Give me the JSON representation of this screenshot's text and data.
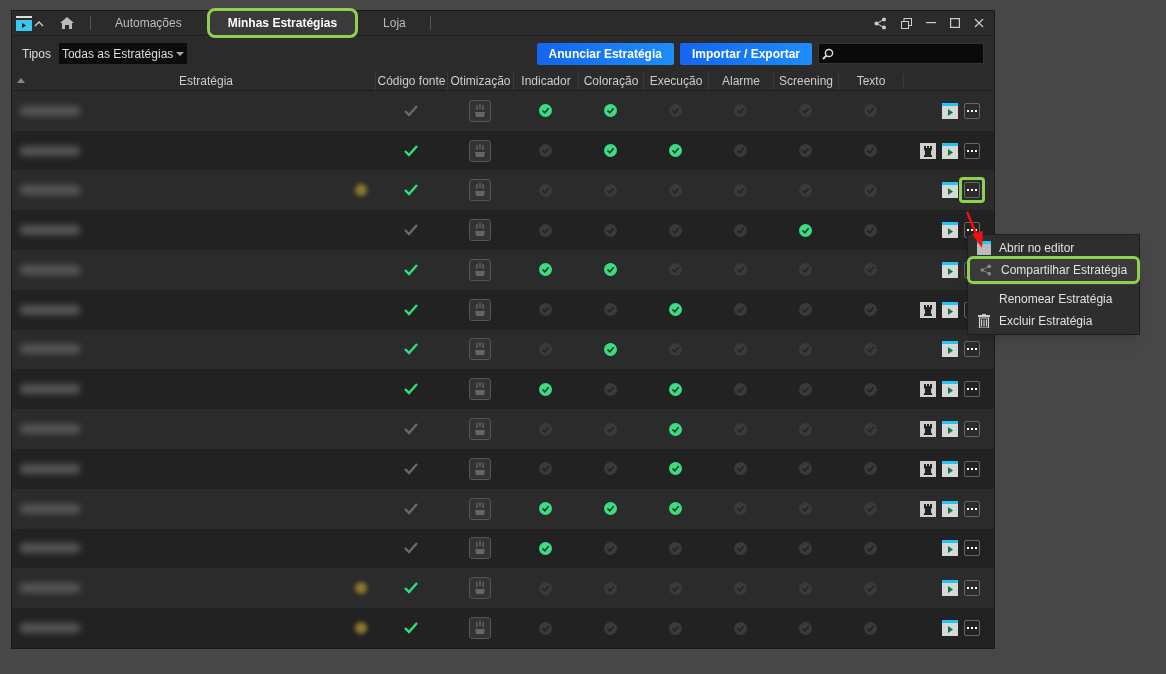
{
  "tabs": [
    {
      "label": "Automações",
      "selected": false,
      "highlighted": false
    },
    {
      "label": "Minhas Estratégias",
      "selected": true,
      "highlighted": true
    },
    {
      "label": "Loja",
      "selected": false,
      "highlighted": false
    }
  ],
  "filter": {
    "label": "Tipos",
    "value": "Todas as Estratégias"
  },
  "buttons": [
    "Anunciar Estratégia",
    "Importar / Exportar"
  ],
  "columns": [
    "Estratégia",
    "Código fonte",
    "Otimização",
    "Indicador",
    "Coloração",
    "Execução",
    "Alarme",
    "Screening",
    "Texto"
  ],
  "rows": [
    {
      "favorite": false,
      "source": false,
      "flags": [
        true,
        true,
        false,
        false,
        false,
        false
      ],
      "rook": false,
      "menu_highlighted": false
    },
    {
      "favorite": false,
      "source": true,
      "flags": [
        false,
        true,
        true,
        false,
        false,
        false
      ],
      "rook": true,
      "menu_highlighted": false
    },
    {
      "favorite": true,
      "source": true,
      "flags": [
        false,
        false,
        false,
        false,
        false,
        false
      ],
      "rook": false,
      "menu_highlighted": true
    },
    {
      "favorite": false,
      "source": false,
      "flags": [
        false,
        false,
        false,
        false,
        true,
        false
      ],
      "rook": false,
      "menu_highlighted": false
    },
    {
      "favorite": false,
      "source": true,
      "flags": [
        true,
        true,
        false,
        false,
        false,
        false
      ],
      "rook": false,
      "menu_highlighted": false
    },
    {
      "favorite": false,
      "source": true,
      "flags": [
        false,
        false,
        true,
        false,
        false,
        false
      ],
      "rook": true,
      "menu_highlighted": false
    },
    {
      "favorite": false,
      "source": true,
      "flags": [
        false,
        true,
        false,
        false,
        false,
        false
      ],
      "rook": false,
      "menu_highlighted": false
    },
    {
      "favorite": false,
      "source": true,
      "flags": [
        true,
        false,
        true,
        false,
        false,
        false
      ],
      "rook": true,
      "menu_highlighted": false
    },
    {
      "favorite": false,
      "source": false,
      "flags": [
        false,
        false,
        true,
        false,
        false,
        false
      ],
      "rook": true,
      "menu_highlighted": false
    },
    {
      "favorite": false,
      "source": false,
      "flags": [
        false,
        false,
        true,
        false,
        false,
        false
      ],
      "rook": true,
      "menu_highlighted": false
    },
    {
      "favorite": false,
      "source": false,
      "flags": [
        true,
        true,
        true,
        false,
        false,
        false
      ],
      "rook": true,
      "menu_highlighted": false
    },
    {
      "favorite": false,
      "source": false,
      "flags": [
        true,
        false,
        false,
        false,
        false,
        false
      ],
      "rook": false,
      "menu_highlighted": false
    },
    {
      "favorite": true,
      "source": true,
      "flags": [
        false,
        false,
        false,
        false,
        false,
        false
      ],
      "rook": false,
      "menu_highlighted": false
    },
    {
      "favorite": true,
      "source": true,
      "flags": [
        false,
        false,
        false,
        false,
        false,
        false
      ],
      "rook": false,
      "menu_highlighted": false
    }
  ],
  "context_menu": [
    {
      "label": "Abrir no editor",
      "kind": "editor",
      "highlighted": false
    },
    {
      "label": "Compartilhar Estratégia",
      "kind": "share",
      "highlighted": true
    },
    {
      "label": "Renomear Estratégia",
      "kind": "plain",
      "highlighted": false
    },
    {
      "label": "Excluir Estratégia",
      "kind": "delete",
      "highlighted": false
    }
  ]
}
